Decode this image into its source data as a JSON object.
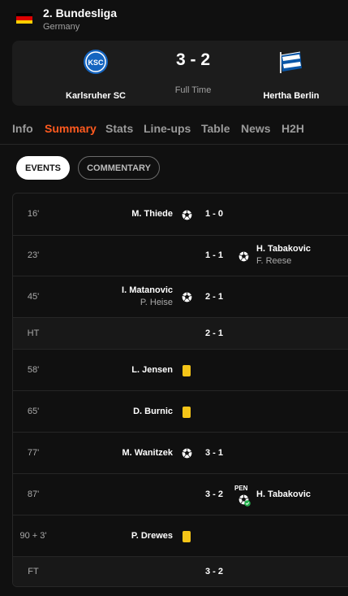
{
  "competition": {
    "name": "2. Bundesliga",
    "country": "Germany",
    "flag_colors": [
      "#000000",
      "#dd0000",
      "#ffce00"
    ]
  },
  "match": {
    "home": {
      "name": "Karlsruher SC",
      "logo_text": "KSC",
      "color": "#1565c0"
    },
    "away": {
      "name": "Hertha Berlin",
      "color": "#0a56a6"
    },
    "score": "3 - 2",
    "status": "Full Time"
  },
  "tabs": [
    {
      "label": "Info"
    },
    {
      "label": "Summary",
      "active": true
    },
    {
      "label": "Stats"
    },
    {
      "label": "Line-ups"
    },
    {
      "label": "Table"
    },
    {
      "label": "News"
    },
    {
      "label": "H2H"
    }
  ],
  "toggles": {
    "events": "EVENTS",
    "commentary": "COMMENTARY"
  },
  "accent_color": "#ff5a1f",
  "events": [
    {
      "minute": "16'",
      "side": "home",
      "type": "goal",
      "player": "M. Thiede",
      "assist": "",
      "score": "1 - 0"
    },
    {
      "minute": "23'",
      "side": "away",
      "type": "goal",
      "player": "H. Tabakovic",
      "assist": "F. Reese",
      "score": "1 - 1"
    },
    {
      "minute": "45'",
      "side": "home",
      "type": "goal",
      "player": "I. Matanovic",
      "assist": "P. Heise",
      "score": "2 - 1"
    },
    {
      "minute": "HT",
      "side": "none",
      "type": "summary",
      "player": "",
      "assist": "",
      "score": "2 - 1"
    },
    {
      "minute": "58'",
      "side": "home",
      "type": "yellow-card",
      "player": "L. Jensen",
      "assist": "",
      "score": ""
    },
    {
      "minute": "65'",
      "side": "home",
      "type": "yellow-card",
      "player": "D. Burnic",
      "assist": "",
      "score": ""
    },
    {
      "minute": "77'",
      "side": "home",
      "type": "goal",
      "player": "M. Wanitzek",
      "assist": "",
      "score": "3 - 1"
    },
    {
      "minute": "87'",
      "side": "away",
      "type": "penalty-goal",
      "player": "H. Tabakovic",
      "assist": "",
      "score": "3 - 2",
      "badge": "PEN"
    },
    {
      "minute": "90 + 3'",
      "side": "home",
      "type": "yellow-card",
      "player": "P. Drewes",
      "assist": "",
      "score": ""
    },
    {
      "minute": "FT",
      "side": "none",
      "type": "summary",
      "player": "",
      "assist": "",
      "score": "3 - 2"
    }
  ]
}
